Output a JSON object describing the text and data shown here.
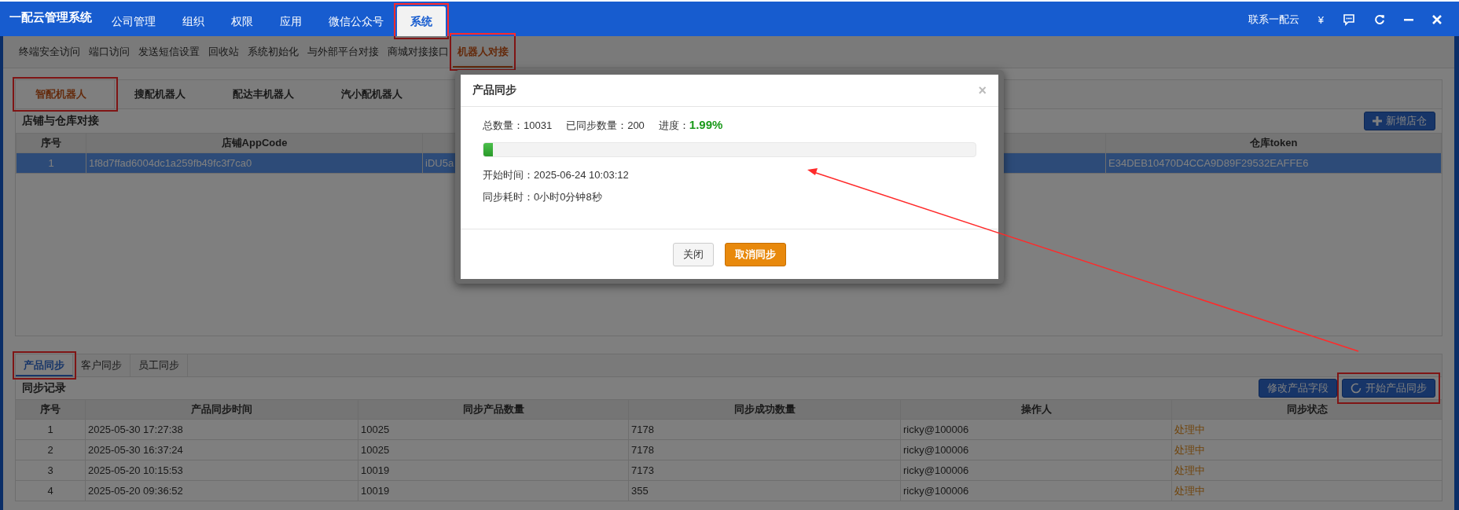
{
  "app_title": "一配云管理系统",
  "top_nav": [
    {
      "label": "公司管理",
      "selected": false,
      "highlighted": false
    },
    {
      "label": "组织",
      "selected": false,
      "highlighted": false
    },
    {
      "label": "权限",
      "selected": false,
      "highlighted": false
    },
    {
      "label": "应用",
      "selected": false,
      "highlighted": false
    },
    {
      "label": "微信公众号",
      "selected": false,
      "highlighted": false
    },
    {
      "label": "系统",
      "selected": true,
      "highlighted": true
    }
  ],
  "top_right": {
    "contact": "联系一配云",
    "currency": "¥"
  },
  "sub_nav": [
    {
      "label": "终端安全访问",
      "selected": false,
      "highlighted": false
    },
    {
      "label": "端口访问",
      "selected": false,
      "highlighted": false
    },
    {
      "label": "发送短信设置",
      "selected": false,
      "highlighted": false
    },
    {
      "label": "回收站",
      "selected": false,
      "highlighted": false
    },
    {
      "label": "系统初始化",
      "selected": false,
      "highlighted": false
    },
    {
      "label": "与外部平台对接",
      "selected": false,
      "highlighted": false
    },
    {
      "label": "商城对接接口",
      "selected": false,
      "highlighted": false
    },
    {
      "label": "机器人对接",
      "selected": true,
      "highlighted": true
    }
  ],
  "robot_tabs": [
    {
      "label": "智配机器人",
      "selected": true,
      "highlighted": true
    },
    {
      "label": "搜配机器人",
      "selected": false,
      "highlighted": false
    },
    {
      "label": "配达丰机器人",
      "selected": false,
      "highlighted": false
    },
    {
      "label": "汽小配机器人",
      "selected": false,
      "highlighted": false
    }
  ],
  "store_section": {
    "title": "店铺与仓库对接",
    "add_button": "新增店仓",
    "table": {
      "columns": [
        {
          "label": "序号"
        },
        {
          "label": "店铺AppCode"
        },
        {},
        {
          "label": "仓库token"
        }
      ],
      "rows": [
        {
          "selected": true,
          "cells": [
            "1",
            "1f8d7ffad6004dc1a259fb49fc3f7ca0",
            "iDU5a",
            "E34DEB10470D4CCA9D89F29532EAFFE6"
          ]
        }
      ]
    }
  },
  "sync_tabs": [
    {
      "label": "产品同步",
      "selected": true,
      "highlighted": true
    },
    {
      "label": "客户同步",
      "selected": false,
      "highlighted": false
    },
    {
      "label": "员工同步",
      "selected": false,
      "highlighted": false
    }
  ],
  "sync_section": {
    "title": "同步记录",
    "buttons": [
      {
        "label": "修改产品字段",
        "highlighted": false
      },
      {
        "label": "开始产品同步",
        "highlighted": true
      }
    ],
    "table": {
      "columns": [
        "序号",
        "产品同步时间",
        "同步产品数量",
        "同步成功数量",
        "操作人",
        "同步状态"
      ],
      "rows": [
        {
          "cells": [
            "1",
            "2025-05-30 17:27:38",
            "10025",
            "7178",
            "ricky@100006",
            "处理中"
          ]
        },
        {
          "cells": [
            "2",
            "2025-05-30 16:37:24",
            "10025",
            "7178",
            "ricky@100006",
            "处理中"
          ]
        },
        {
          "cells": [
            "3",
            "2025-05-20 10:15:53",
            "10019",
            "7173",
            "ricky@100006",
            "处理中"
          ]
        },
        {
          "cells": [
            "4",
            "2025-05-20 09:36:52",
            "10019",
            "355",
            "ricky@100006",
            "处理中"
          ]
        }
      ]
    }
  },
  "dialog": {
    "title": "产品同步",
    "close": "×",
    "total_label": "总数量：",
    "total": "10031",
    "synced_label": "已同步数量：",
    "synced": "200",
    "progress_label": "进度：",
    "progress": "1.99%",
    "level": 0.0199,
    "start_time": "开始时间：2025-06-24 10:03:12",
    "elapsed": "同步耗时：0小时0分钟8秒",
    "buttons": [
      {
        "label": "关闭",
        "kind": "default"
      },
      {
        "label": "取消同步",
        "kind": "warning"
      }
    ]
  }
}
